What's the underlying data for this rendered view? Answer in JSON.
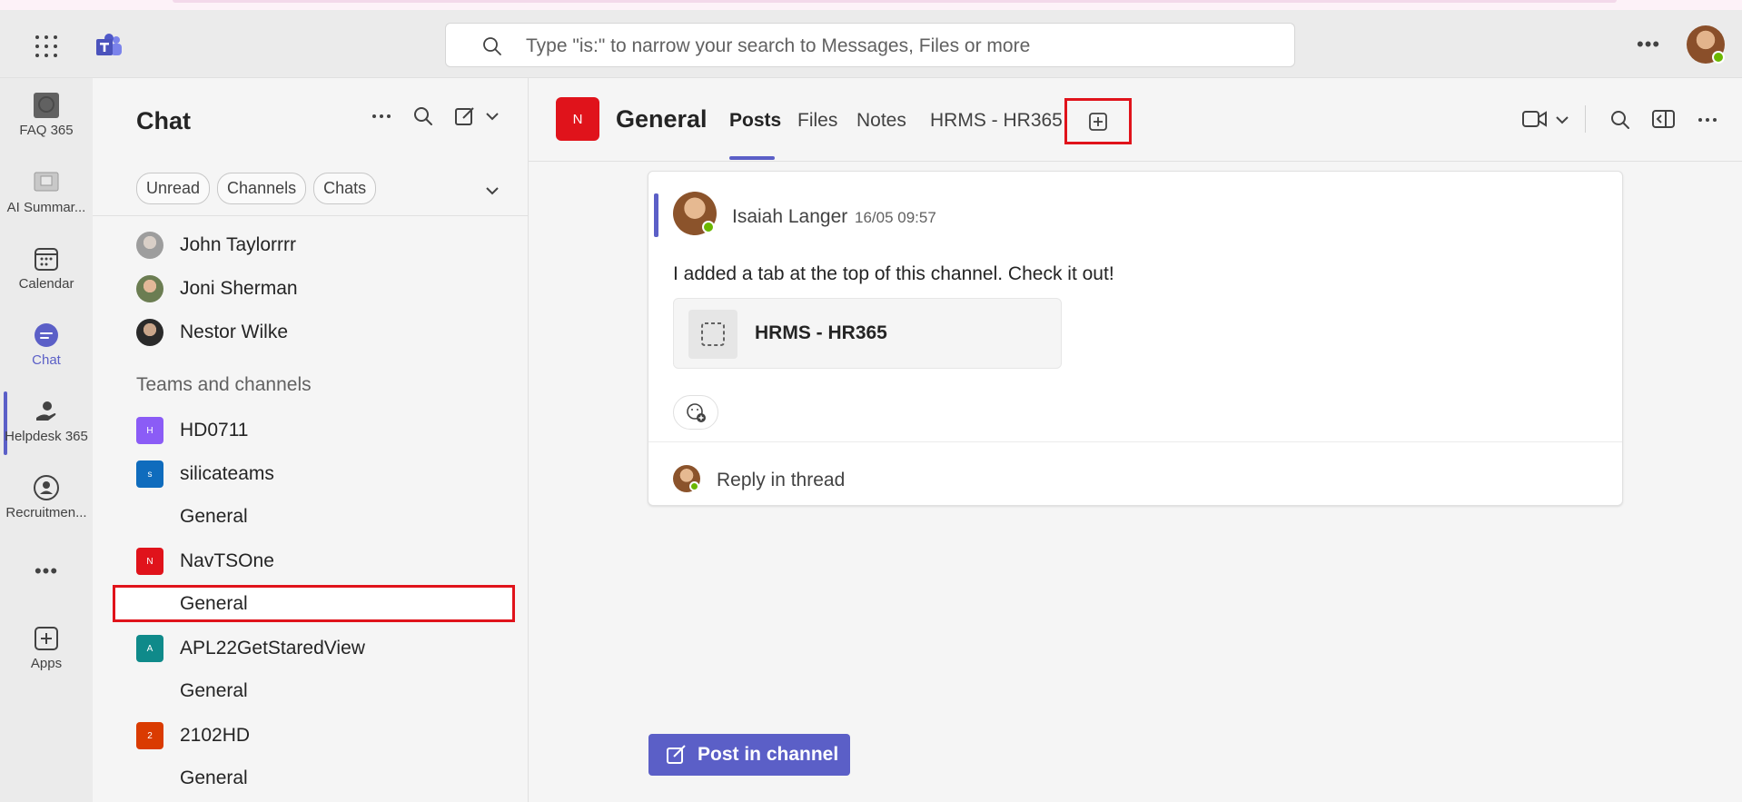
{
  "search": {
    "placeholder": "Type \"is:\" to narrow your search to Messages, Files or more"
  },
  "rail": {
    "items": [
      {
        "label": "FAQ 365",
        "icon": "faq-app-icon"
      },
      {
        "label": "AI Summar...",
        "icon": "ai-summary-app-icon"
      },
      {
        "label": "Calendar",
        "icon": "calendar-icon"
      },
      {
        "label": "Chat",
        "icon": "chat-icon",
        "active": true
      },
      {
        "label": "Helpdesk 365",
        "icon": "helpdesk-icon"
      },
      {
        "label": "Recruitmen...",
        "icon": "recruitment-icon"
      },
      {
        "label": "",
        "icon": "more-apps-icon"
      },
      {
        "label": "Apps",
        "icon": "apps-icon"
      }
    ],
    "more": "•••"
  },
  "list": {
    "title": "Chat",
    "filters": [
      "Unread",
      "Channels",
      "Chats"
    ],
    "contacts": [
      {
        "name": "John Taylorrrr"
      },
      {
        "name": "Joni Sherman"
      },
      {
        "name": "Nestor Wilke"
      }
    ],
    "section_label": "Teams and channels",
    "teams": [
      {
        "initial": "H",
        "name": "HD0711",
        "color": "#8b5cf6",
        "channels": []
      },
      {
        "initial": "s",
        "name": "silicateams",
        "color": "#0f6cbd",
        "channels": [
          "General"
        ]
      },
      {
        "initial": "N",
        "name": "NavTSOne",
        "color": "#e0131b",
        "channels": [
          "General"
        ]
      },
      {
        "initial": "A",
        "name": "APL22GetStaredView",
        "color": "#0f8a8a",
        "channels": [
          "General"
        ]
      },
      {
        "initial": "2",
        "name": "2102HD",
        "color": "#da3b01",
        "channels": [
          "General"
        ]
      }
    ]
  },
  "channel": {
    "badge": "N",
    "name": "General",
    "tabs": [
      "Posts",
      "Files",
      "Notes",
      "HRMS - HR365"
    ],
    "active_tab": "Posts"
  },
  "post": {
    "author": "Isaiah Langer",
    "time": "16/05 09:57",
    "body": "I added a tab at the top of this channel. Check it out!",
    "attachment": "HRMS - HR365",
    "reply_label": "Reply in thread"
  },
  "compose": {
    "label": "Post in channel"
  },
  "colors": {
    "accent": "#5b5fc7",
    "highlight": "#e0131b",
    "presence": "#6bb700"
  }
}
